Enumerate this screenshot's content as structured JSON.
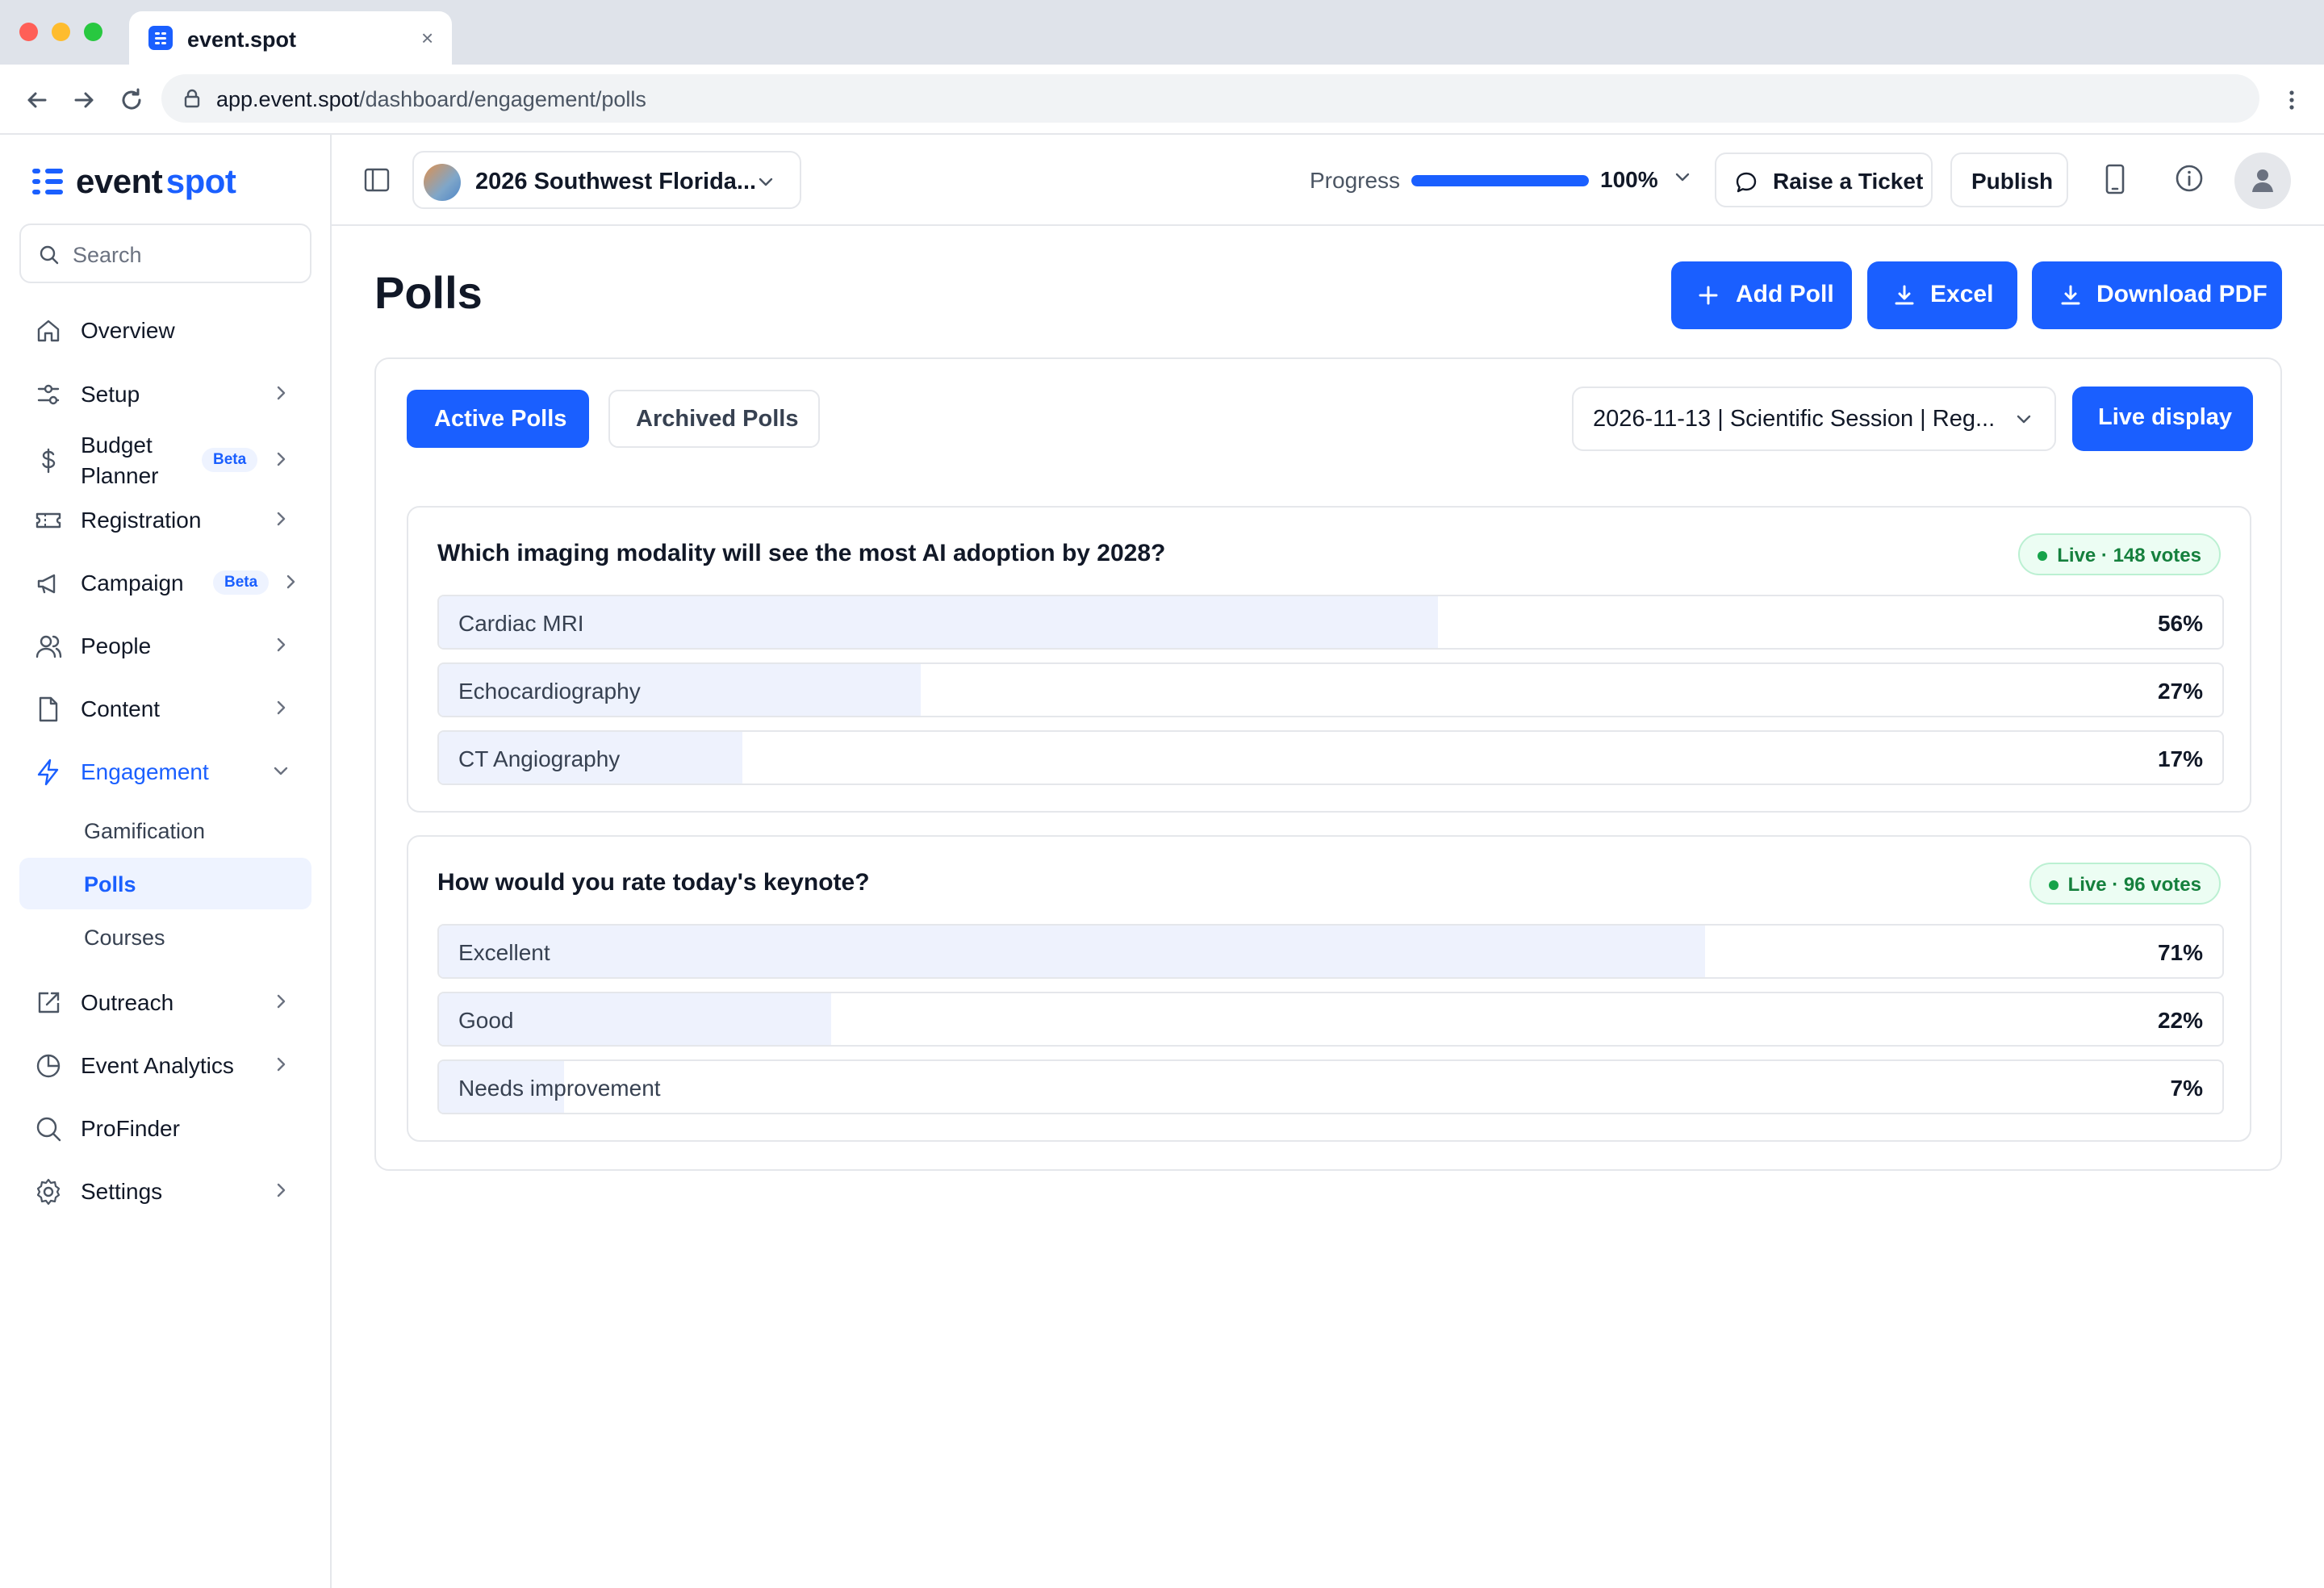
{
  "browser": {
    "tab_title": "event.spot",
    "url_host": "app.event.spot",
    "url_path": "/dashboard/engagement/polls"
  },
  "colors": {
    "accent": "#1a5fff",
    "live_green": "#16a34a",
    "bar_fill": "#eef2fd"
  },
  "sidebar": {
    "logo_main": "event",
    "logo_accent": "spot",
    "search_placeholder": "Search",
    "items": [
      {
        "label": "Overview",
        "icon": "home-icon"
      },
      {
        "label": "Setup",
        "icon": "sliders-icon"
      },
      {
        "label": "Budget Planner",
        "icon": "dollar-icon",
        "badge": "Beta"
      },
      {
        "label": "Registration",
        "icon": "ticket-icon"
      },
      {
        "label": "Campaign",
        "icon": "megaphone-icon",
        "badge": "Beta"
      },
      {
        "label": "People",
        "icon": "people-icon"
      },
      {
        "label": "Content",
        "icon": "file-icon"
      },
      {
        "label": "Engagement",
        "icon": "bolt-icon",
        "expanded": true
      },
      {
        "label": "Outreach",
        "icon": "share-icon"
      },
      {
        "label": "Event Analytics",
        "icon": "pie-chart-icon"
      },
      {
        "label": "ProFinder",
        "icon": "search-icon"
      },
      {
        "label": "Settings",
        "icon": "gear-icon"
      }
    ],
    "engagement_sub": [
      "Gamification",
      "Polls",
      "Courses"
    ],
    "active_sub": "Polls"
  },
  "header": {
    "event_name": "2026 Southwest Florida...",
    "progress_label": "Progress",
    "progress_value": "100%",
    "progress_fraction": 1.0,
    "raise_ticket": "Raise a Ticket",
    "publish": "Publish"
  },
  "page": {
    "title": "Polls",
    "add_poll": "Add Poll",
    "excel": "Excel",
    "download_pdf": "Download PDF",
    "tab_active": "Active Polls",
    "tab_archived": "Archived Polls",
    "session": "2026-11-13 | Scientific Session | Reg...",
    "live_display": "Live display"
  },
  "polls": [
    {
      "question": "Which imaging modality will see the most AI adoption by 2028?",
      "status": "Live · 148 votes",
      "options": [
        {
          "label": "Cardiac MRI",
          "percent": "56%",
          "fraction": 0.56
        },
        {
          "label": "Echocardiography",
          "percent": "27%",
          "fraction": 0.27
        },
        {
          "label": "CT Angiography",
          "percent": "17%",
          "fraction": 0.17
        }
      ]
    },
    {
      "question": "How would you rate today's keynote?",
      "status": "Live · 96 votes",
      "options": [
        {
          "label": "Excellent",
          "percent": "71%",
          "fraction": 0.71
        },
        {
          "label": "Good",
          "percent": "22%",
          "fraction": 0.22
        },
        {
          "label": "Needs improvement",
          "percent": "7%",
          "fraction": 0.07
        }
      ]
    }
  ]
}
